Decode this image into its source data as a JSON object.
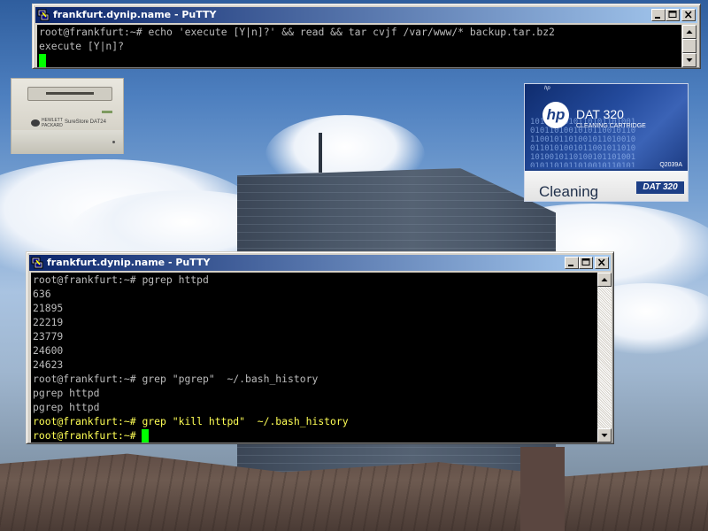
{
  "desktop": {
    "tape_drive": {
      "brand_line1": "HEWLETT",
      "brand_line2": "PACKARD",
      "model": "SureStore DAT24"
    },
    "cartridge": {
      "hp_logo": "hp",
      "small_hp": "hp",
      "product": "DAT 320",
      "subtitle": "CLEANING CARTRIDGE",
      "part_number": "Q2039A",
      "label": "Cleaning",
      "dat_logo": "DAT 320"
    }
  },
  "window_top": {
    "title": "frankfurt.dynip.name - PuTTY",
    "lines": [
      {
        "text": "root@frankfurt:~# echo 'execute [Y|n]?' && read && tar cvjf /var/www/* backup.tar.bz2"
      },
      {
        "text": "execute [Y|n]?"
      }
    ]
  },
  "window_bottom": {
    "title": "frankfurt.dynip.name - PuTTY",
    "lines": [
      {
        "text": "root@frankfurt:~# pgrep httpd"
      },
      {
        "text": "636"
      },
      {
        "text": "21895"
      },
      {
        "text": "22219"
      },
      {
        "text": "23779"
      },
      {
        "text": "24600"
      },
      {
        "text": "24623"
      },
      {
        "text": "root@frankfurt:~# grep \"pgrep\"  ~/.bash_history"
      },
      {
        "text": "pgrep httpd"
      },
      {
        "text": "pgrep httpd"
      },
      {
        "text": "root@frankfurt:~# grep \"kill httpd\"  ~/.bash_history"
      },
      {
        "text": "root@frankfurt:~# "
      }
    ]
  },
  "colors": {
    "terminal_bg": "#000000",
    "terminal_text": "#bbbbbb",
    "terminal_highlight": "#ffff55",
    "cursor": "#00ff00",
    "titlebar_start": "#0a246a",
    "titlebar_end": "#a6caf0"
  },
  "icons": {
    "putty": "putty-icon",
    "minimize": "minimize-icon",
    "maximize": "maximize-icon",
    "close": "close-icon",
    "scroll_up": "scroll-up-arrow-icon",
    "scroll_down": "scroll-down-arrow-icon"
  }
}
